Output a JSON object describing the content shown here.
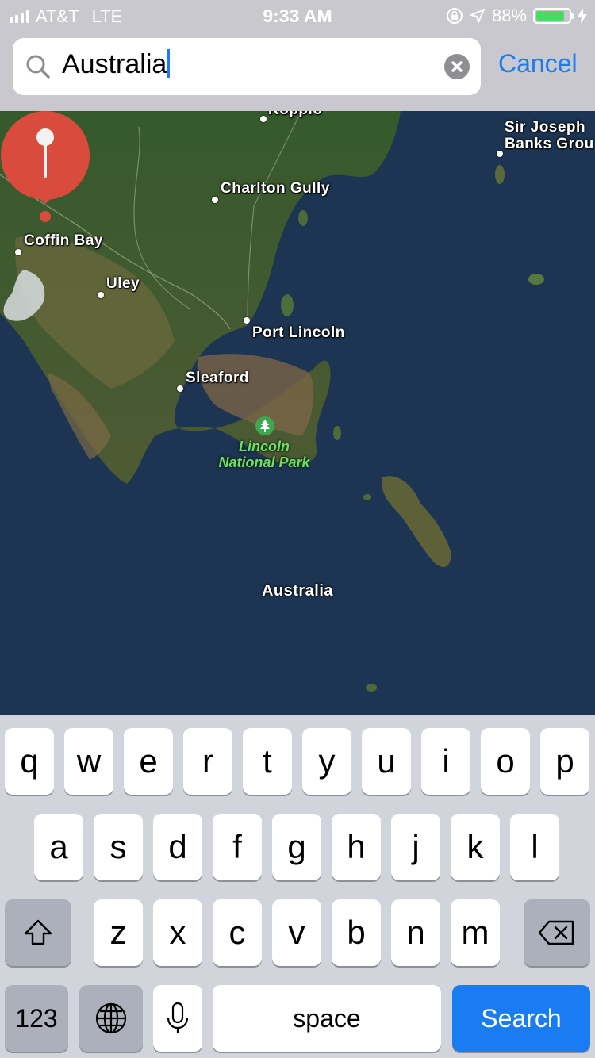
{
  "status_bar": {
    "carrier": "AT&T",
    "network": "LTE",
    "time": "9:33 AM",
    "battery_percent": "88%",
    "battery_level": 0.88,
    "icons": [
      "signal-bars-icon",
      "orientation-lock-icon",
      "location-arrow-icon",
      "battery-icon",
      "charging-bolt-icon"
    ]
  },
  "search": {
    "value": "Australia",
    "placeholder": "",
    "cancel_label": "Cancel"
  },
  "map": {
    "labels": {
      "koppio": "Koppio",
      "sir_joseph": "Sir Joseph",
      "banks_group": "Banks Grou",
      "charlton_gully": "Charlton Gully",
      "coffin_bay": "Coffin Bay",
      "uley": "Uley",
      "port_lincoln": "Port Lincoln",
      "sleaford": "Sleaford",
      "lincoln": "Lincoln",
      "national_park": "National Park",
      "pin_label": "Australia"
    },
    "colors": {
      "water": "#1d3452",
      "pin": "#d94b3d",
      "park": "#6ee06a"
    }
  },
  "keyboard": {
    "row1": [
      "q",
      "w",
      "e",
      "r",
      "t",
      "y",
      "u",
      "i",
      "o",
      "p"
    ],
    "row2": [
      "a",
      "s",
      "d",
      "f",
      "g",
      "h",
      "j",
      "k",
      "l"
    ],
    "row3": [
      "z",
      "x",
      "c",
      "v",
      "b",
      "n",
      "m"
    ],
    "numbers_label": "123",
    "space_label": "space",
    "search_label": "Search",
    "icons": [
      "shift-icon",
      "backspace-icon",
      "globe-icon",
      "microphone-icon"
    ],
    "accent": "#1a7cf2"
  }
}
